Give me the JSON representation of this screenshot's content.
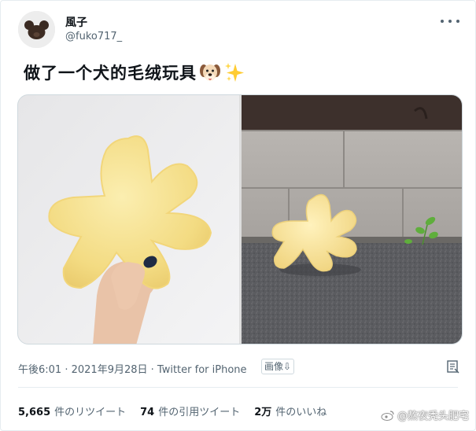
{
  "author": {
    "display_name": "風子",
    "handle": "@fuko717_",
    "avatar_icon": "bear-avatar-icon"
  },
  "tweet": {
    "text": "做了一个犬的毛绒玩具",
    "emojis": [
      "dog-face-emoji",
      "sparkles-emoji"
    ],
    "media": [
      {
        "name": "photo-star-plush-held",
        "alt_icon": "image"
      },
      {
        "name": "photo-star-plush-sidewalk",
        "alt_icon": "image"
      }
    ]
  },
  "meta": {
    "time": "午後6:01",
    "separator": " · ",
    "date": "2021年9月28日",
    "source": "Twitter for iPhone",
    "translate_label": "画像⇩"
  },
  "stats": {
    "retweets_count": "5,665",
    "retweets_label": "件のリツイート",
    "quotes_count": "74",
    "quotes_label": "件の引用ツイート",
    "likes_count": "2万",
    "likes_label": "件のいいね"
  },
  "watermark": {
    "text": "@熬夜秃头肥宅"
  },
  "colors": {
    "text_primary": "#0f1419",
    "text_secondary": "#536471",
    "border": "#e6ecf0",
    "plush_yellow": "#f6e08a"
  }
}
